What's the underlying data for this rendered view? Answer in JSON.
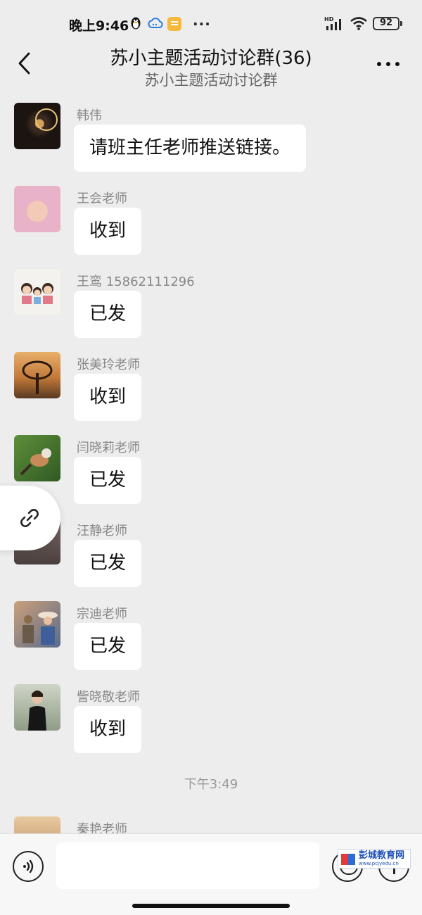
{
  "status_bar": {
    "time": "晚上9:46",
    "more": "···",
    "battery": "92",
    "network": "HD"
  },
  "header": {
    "title": "苏小主题活动讨论群(36)",
    "subtitle": "苏小主题活动讨论群"
  },
  "messages": [
    {
      "sender": "韩伟",
      "text": "请班主任老师推送链接。"
    },
    {
      "sender": "王会老师",
      "text": "收到"
    },
    {
      "sender": "王鸾 15862111296",
      "text": "已发"
    },
    {
      "sender": "张美玲老师",
      "text": "收到"
    },
    {
      "sender": "闫晓莉老师",
      "text": "已发"
    },
    {
      "sender": "汪静老师",
      "text": "已发"
    },
    {
      "sender": "宗迪老师",
      "text": "已发"
    },
    {
      "sender": "訾晓敬老师",
      "text": "收到"
    }
  ],
  "timestamp": "下午3:49",
  "last_sender": "秦艳老师",
  "input": {
    "value": "",
    "placeholder": ""
  },
  "watermark": {
    "main": "彭城教育网",
    "sub": "www.pcjyedu.cn"
  },
  "icons": [
    "back-arrow-icon",
    "more-dots-icon",
    "link-icon",
    "voice-icon",
    "emoji-icon",
    "plus-icon"
  ],
  "colors": {
    "background": "#ededed",
    "bubble": "#ffffff",
    "name": "#888888"
  }
}
